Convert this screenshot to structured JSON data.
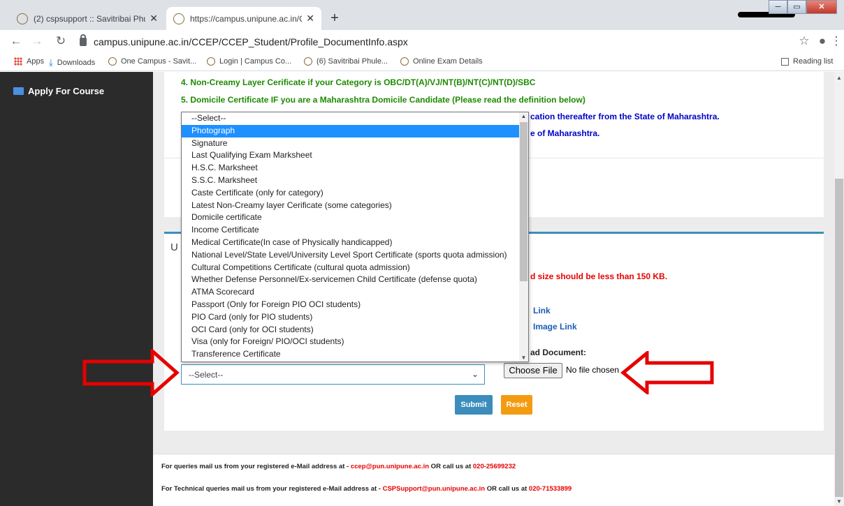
{
  "browser": {
    "tabs": [
      {
        "title": "(2) cspsupport :: Savitribai Phule",
        "close": "✕"
      },
      {
        "title": "https://campus.unipune.ac.in/CCI",
        "close": "✕"
      }
    ],
    "new_tab": "+",
    "window_controls": {
      "minimize": "─",
      "restore": "▭",
      "close": "✕"
    },
    "nav": {
      "back": "←",
      "forward": "→",
      "reload": "↻"
    },
    "url": "campus.unipune.ac.in/CCEP/CCEP_Student/Profile_DocumentInfo.aspx",
    "star": "☆",
    "menu": "⋮",
    "profile": "●",
    "bookmarks": [
      {
        "label": "Apps",
        "icon": "apps-grid-icon"
      },
      {
        "label": "Downloads",
        "icon": "download-icon"
      },
      {
        "label": "One Campus - Savit...",
        "icon": "site-favicon-icon"
      },
      {
        "label": "Login | Campus Co...",
        "icon": "site-favicon-icon"
      },
      {
        "label": "(6) Savitribai Phule...",
        "icon": "site-favicon-icon"
      },
      {
        "label": "Online Exam Details",
        "icon": "site-favicon-icon"
      }
    ],
    "reading_list": "Reading list"
  },
  "sidebar": {
    "apply_for_course": "Apply For Course"
  },
  "instructions": {
    "item4": "4. Non-Creamy Layer Cerificate if your Category is OBC/DT(A)/VJ/NT(B)/NT(C)/NT(D)/SBC",
    "item5": "5. Domicile Certificate IF you are a Maharashtra Domicile Candidate (Please read the definition below)",
    "domicile_line1_tail": "cation thereafter from the State of Maharashtra.",
    "domicile_line2_tail": "e of Maharashtra."
  },
  "upload_section": {
    "title_fragment": "U",
    "size_note_tail": "d size should be less than 150 KB.",
    "link1_tail": "Link",
    "link2_tail": "Image Link",
    "upload_label_tail": "ad Document:",
    "document_type_select": {
      "selected": "--Select--",
      "chevron": "⌄"
    },
    "file_input": {
      "button": "Choose File",
      "status": "No file chosen"
    },
    "submit": "Submit",
    "reset": "Reset"
  },
  "dropdown_options": [
    "--Select--",
    "Photograph",
    "Signature",
    "Last Qualifying Exam Marksheet",
    "H.S.C. Marksheet",
    "S.S.C. Marksheet",
    "Caste Certificate (only for category)",
    "Latest Non-Creamy layer Cerificate (some categories)",
    "Domicile certificate",
    "Income Certificate",
    "Medical Certificate(In case of Physically handicapped)",
    "National Level/State Level/University Level Sport Certificate (sports quota admission)",
    "Cultural Competitions Certificate (cultural quota admission)",
    "Whether Defense Personnel/Ex-servicemen Child Certificate (defense quota)",
    "ATMA Scorecard",
    "Passport (Only for Foreign PIO OCI students)",
    "PIO Card (only for PIO students)",
    "OCI Card (only for OCI students)",
    "Visa (only for Foreign/ PIO/OCI students)",
    "Transference Certificate"
  ],
  "dropdown_highlighted": "Photograph",
  "footer": {
    "line1_prefix": "For queries mail us from your registered e-Mail address at - ",
    "line1_email": "ccep@pun.unipune.ac.in",
    "line1_mid": " OR call us at ",
    "line1_phone": "020-25699232",
    "line2_prefix": "For Technical queries mail us from your registered e-Mail address at - ",
    "line2_email": "CSPSupport@pun.unipune.ac.in",
    "line2_mid": " OR call us at ",
    "line2_phone": "020-71533899"
  },
  "colors": {
    "annotation_red": "#e60000",
    "primary_blue": "#3c8dbc",
    "reset_orange": "#f39c12"
  }
}
